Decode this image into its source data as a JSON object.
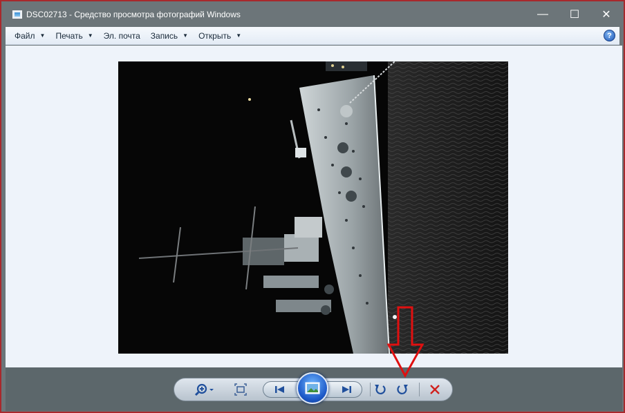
{
  "window": {
    "title": "DSC02713 - Средство просмотра фотографий Windows",
    "controls": {
      "minimize": "—",
      "maximize": "☐",
      "close": "✕"
    }
  },
  "menu": {
    "items": [
      {
        "label": "Файл",
        "has_dropdown": true
      },
      {
        "label": "Печать",
        "has_dropdown": true
      },
      {
        "label": "Эл. почта",
        "has_dropdown": false
      },
      {
        "label": "Запись",
        "has_dropdown": true
      },
      {
        "label": "Открыть",
        "has_dropdown": true
      }
    ],
    "help": "?"
  },
  "toolbar": {
    "buttons": [
      {
        "name": "zoom",
        "icon": "magnifier-plus-icon"
      },
      {
        "name": "actual-size",
        "icon": "fit-window-icon"
      },
      {
        "name": "previous",
        "icon": "skip-previous-icon"
      },
      {
        "name": "slideshow",
        "icon": "slideshow-icon"
      },
      {
        "name": "next",
        "icon": "skip-next-icon"
      },
      {
        "name": "rotate-counterclockwise",
        "icon": "rotate-ccw-icon"
      },
      {
        "name": "rotate-clockwise",
        "icon": "rotate-cw-icon"
      },
      {
        "name": "delete",
        "icon": "delete-x-icon"
      }
    ]
  },
  "annotation": {
    "arrow_color": "#e01010",
    "points_to": "rotate-clockwise"
  },
  "colors": {
    "window_frame": "#a8282c",
    "titlebar": "#6c7579",
    "toolbar": "#5c676b",
    "viewer_bg": "#eef3fa",
    "accent_blue": "#1d59c8",
    "delete_red": "#d0201c"
  }
}
